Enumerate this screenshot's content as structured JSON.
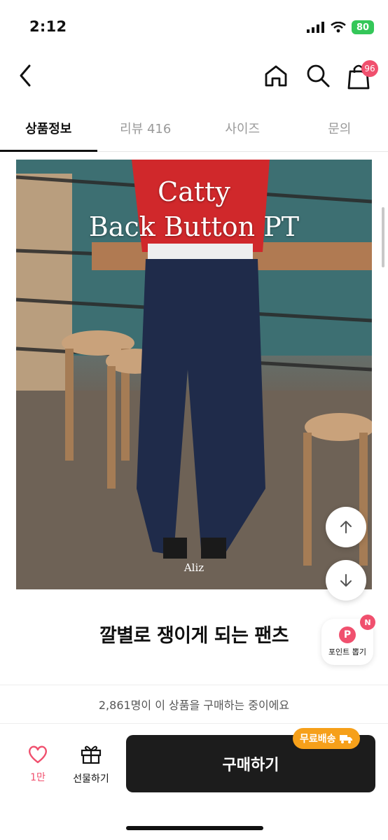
{
  "status_bar": {
    "time": "2:12",
    "battery": "80"
  },
  "nav": {
    "cart_count": "96"
  },
  "tabs": [
    {
      "label": "상품정보",
      "active": true
    },
    {
      "label": "리뷰 416",
      "active": false
    },
    {
      "label": "사이즈",
      "active": false
    },
    {
      "label": "문의",
      "active": false
    }
  ],
  "product_image": {
    "title_line1": "Catty",
    "title_line2": "Back Button PT",
    "brand": "Aliz"
  },
  "headline": "깔별로 쟁이게 되는 팬츠",
  "point_button": {
    "label": "포인트 뽑기",
    "p": "P",
    "badge": "N"
  },
  "purchase_info": "2,861명이 이 상품을 구매하는 중이에요",
  "bottom_bar": {
    "like_count": "1만",
    "gift_label": "선물하기",
    "buy_label": "구매하기",
    "free_shipping_label": "무료배송"
  },
  "colors": {
    "accent_pink": "#f0506e",
    "buy_dark": "#1c1c1c",
    "free_ship_orange": "#f6a01a",
    "battery_green": "#34c759"
  }
}
